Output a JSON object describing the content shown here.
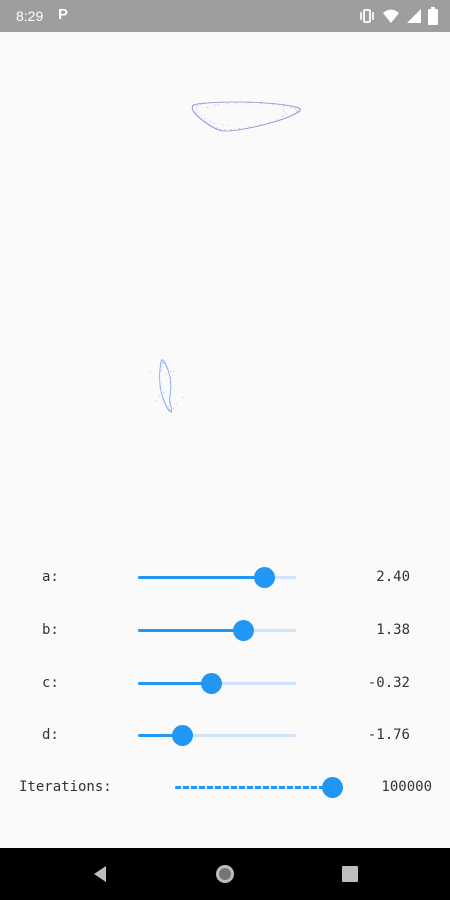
{
  "status_bar": {
    "time": "8:29",
    "app_icon": "P"
  },
  "params": [
    {
      "label": "a:",
      "value": "2.40",
      "fraction": 0.8
    },
    {
      "label": "b:",
      "value": "1.38",
      "fraction": 0.665
    },
    {
      "label": "c:",
      "value": "-0.32",
      "fraction": 0.46
    },
    {
      "label": "d:",
      "value": "-1.76",
      "fraction": 0.28
    }
  ],
  "iterations": {
    "label": "Iterations:",
    "value": "100000",
    "fraction": 1.0
  },
  "colors": {
    "accent": "#2196f3",
    "track": "#cfe3fb",
    "attractor_top": "#3b3fbf",
    "attractor_bottom": "#2f6fe0"
  },
  "icons": [
    "vibrate-icon",
    "wifi-icon",
    "signal-icon",
    "battery-icon",
    "back-icon",
    "home-icon",
    "recents-icon"
  ]
}
